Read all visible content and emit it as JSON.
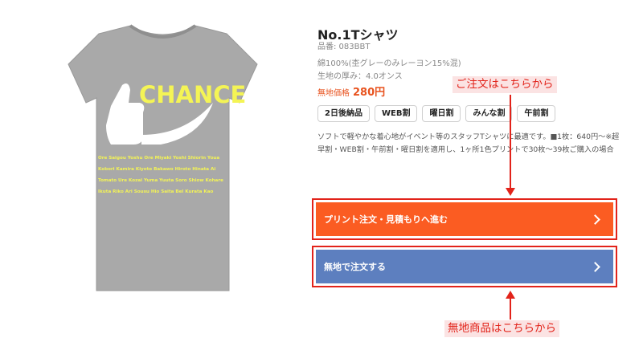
{
  "product": {
    "title": "No.1Tシャツ",
    "sku": "品番: 083BBT",
    "material": "綿100%(杢グレーのみレーヨン15%混)",
    "thickness": "生地の厚み：4.0オンス",
    "price_label": "無地価格",
    "price_value": "280円",
    "tags": [
      "2日後納品",
      "WEB割",
      "曜日割",
      "みんな割",
      "午前割"
    ],
    "description_line1": "ソフトで軽やかな着心地がイベント等のスタッフTシャツに最適です。■1枚：640円〜※超",
    "description_line2": "早割・WEB割・午前割・曜日割を適用し、1ヶ所1色プリントで30枚〜39枚ご購入の場合"
  },
  "shirt_print": {
    "headline": "CHANCE",
    "text_lines": [
      "Ore Saigou Yoshu Ore Miyaki Yoshi Shiorin Youa",
      "Kobori Kamira Kiyoto Bakawo Hiroto Hinata Ai",
      "Tomato Ure Kozai Yuma Yuuta Soro Shiow Kohare",
      "Ikuta Riko Ari Sousu Hio Saita Bel Kurata Kao"
    ],
    "colors": {
      "shirt": "#a9a9a9",
      "print": "#f4f455",
      "hand": "#ffffff"
    }
  },
  "annotations": {
    "top": "ご注文はこちらから",
    "bottom": "無地商品はこちらから",
    "color": "#e2231a"
  },
  "buttons": {
    "print_order": "プリント注文・見積もりへ進む",
    "plain_order": "無地で注文する",
    "print_color": "#fb5c22",
    "plain_color": "#5d7fbf"
  }
}
